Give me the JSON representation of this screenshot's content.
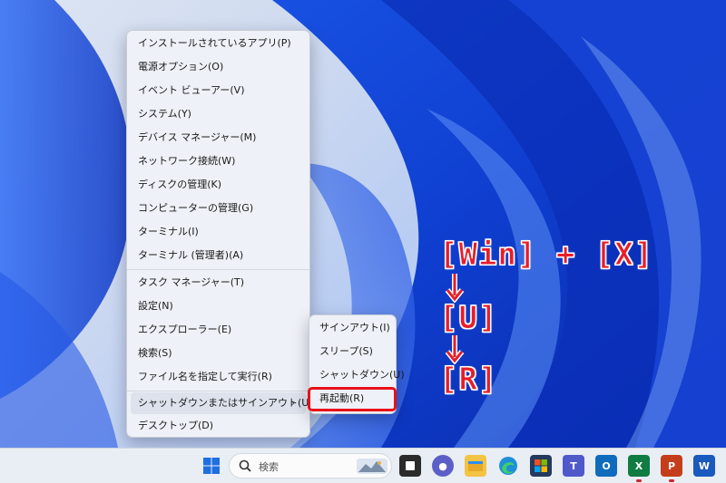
{
  "context_menu": {
    "items": [
      {
        "label": "インストールされているアプリ(P)"
      },
      {
        "label": "電源オプション(O)"
      },
      {
        "label": "イベント ビューアー(V)"
      },
      {
        "label": "システム(Y)"
      },
      {
        "label": "デバイス マネージャー(M)"
      },
      {
        "label": "ネットワーク接続(W)"
      },
      {
        "label": "ディスクの管理(K)"
      },
      {
        "label": "コンピューターの管理(G)"
      },
      {
        "label": "ターミナル(I)"
      },
      {
        "label": "ターミナル (管理者)(A)"
      },
      {
        "label": "タスク マネージャー(T)"
      },
      {
        "label": "設定(N)"
      },
      {
        "label": "エクスプローラー(E)"
      },
      {
        "label": "検索(S)"
      },
      {
        "label": "ファイル名を指定して実行(R)"
      },
      {
        "label": "シャットダウンまたはサインアウト(U)",
        "submenu_chevron": "›"
      },
      {
        "label": "デスクトップ(D)"
      }
    ]
  },
  "sub_menu": {
    "items": [
      {
        "label": "サインアウト(I)"
      },
      {
        "label": "スリープ(S)"
      },
      {
        "label": "シャットダウン(U)"
      },
      {
        "label": "再起動(R)"
      }
    ]
  },
  "annotation": {
    "line1": "[Win] + [X]",
    "line2": "[U]",
    "line3": "[R]",
    "color": "#e81d2a"
  },
  "taskbar": {
    "search_label": "検索",
    "icons": [
      "windows-start-icon",
      "search-icon",
      "task-view-icon",
      "chat-icon",
      "file-explorer-icon",
      "edge-icon",
      "store-icon",
      "teams-icon",
      "outlook-icon",
      "excel-icon",
      "powerpoint-icon",
      "word-icon"
    ]
  }
}
